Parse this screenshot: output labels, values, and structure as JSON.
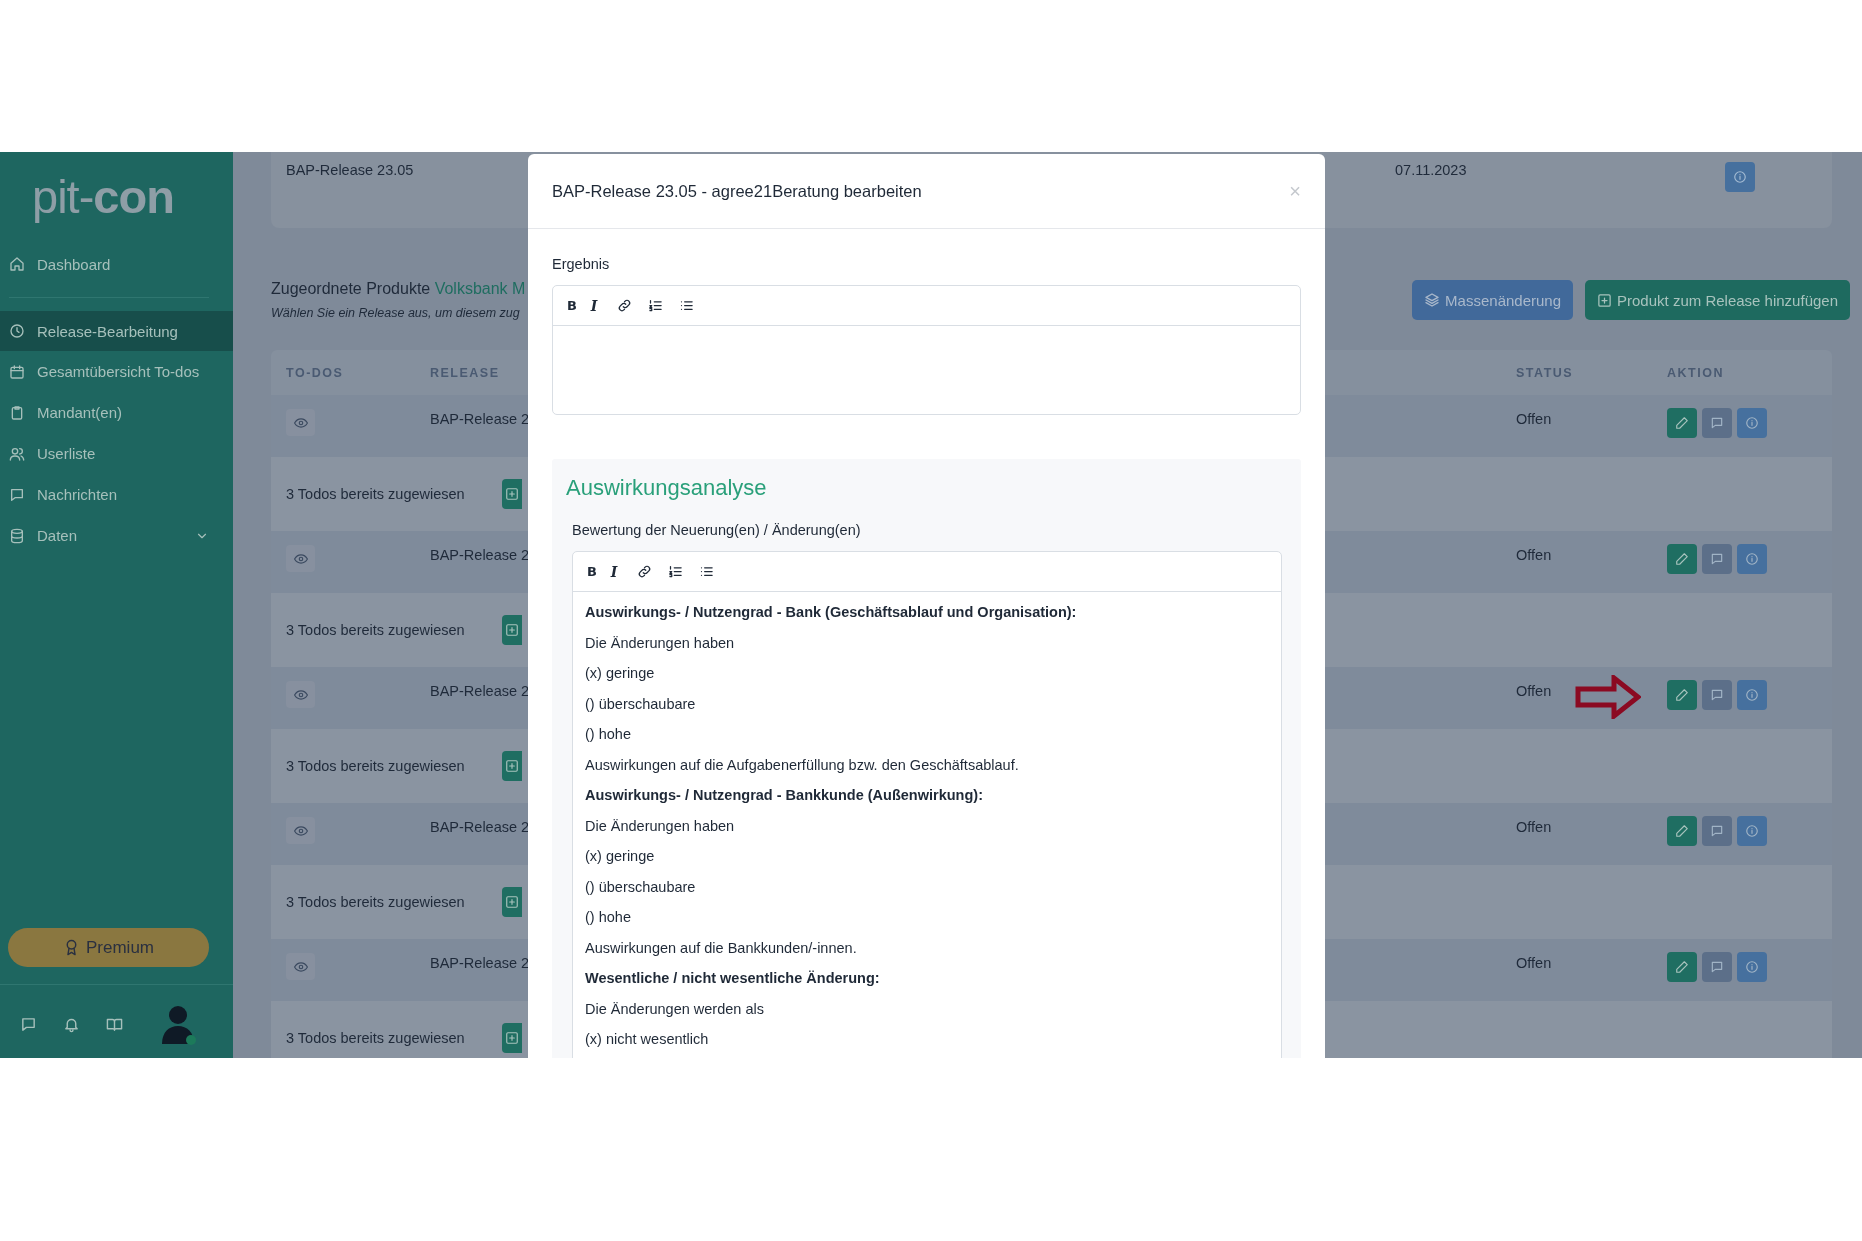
{
  "sidebar": {
    "logo": "pit-**con**",
    "items": [
      {
        "label": "Dashboard",
        "kind": "link",
        "selected": false
      },
      {
        "label": "Release-Bearbeitung",
        "kind": "link",
        "selected": true
      },
      {
        "label": "Gesamtübersicht To-dos",
        "kind": "link",
        "selected": false
      },
      {
        "label": "Mandant(en)",
        "kind": "link",
        "selected": false
      },
      {
        "label": "Userliste",
        "kind": "link",
        "selected": false
      },
      {
        "label": "Nachrichten",
        "kind": "link",
        "selected": false
      },
      {
        "label": "Daten",
        "kind": "group",
        "selected": false
      }
    ],
    "premium_button": "Premium"
  },
  "top_card": {
    "release": "BAP-Release 23.05",
    "date": "07.11.2023"
  },
  "section": {
    "title": "Zugeordnete Produkte",
    "link": "Volksbank M",
    "subtitle": "Wählen Sie ein Release aus, um diesem zug",
    "buttons": [
      "Massenänderung",
      "Produkt zum Release hinzufügen"
    ]
  },
  "table": {
    "columns": [
      "TO-DOS",
      "RELEASE",
      "STATUS",
      "AKTION"
    ],
    "rows": [
      {
        "kind": "release",
        "release": "BAP-Release 2",
        "status": "Offen",
        "marked": false
      },
      {
        "kind": "todos",
        "text": "3 Todos bereits zugewiesen"
      },
      {
        "kind": "release",
        "release": "BAP-Release 2",
        "status": "Offen",
        "marked": false
      },
      {
        "kind": "todos",
        "text": "3 Todos bereits zugewiesen"
      },
      {
        "kind": "release",
        "release": "BAP-Release 2",
        "status": "Offen",
        "marked": true
      },
      {
        "kind": "todos",
        "text": "3 Todos bereits zugewiesen"
      },
      {
        "kind": "release",
        "release": "BAP-Release 2",
        "status": "Offen",
        "marked": false
      },
      {
        "kind": "todos",
        "text": "3 Todos bereits zugewiesen"
      },
      {
        "kind": "release",
        "release": "BAP-Release 2",
        "status": "Offen",
        "marked": false
      },
      {
        "kind": "todos",
        "text": "3 Todos bereits zugewiesen"
      }
    ]
  },
  "modal": {
    "title": "BAP-Release 23.05 - agree21Beratung bearbeiten",
    "close": "×",
    "result_label": "Ergebnis",
    "result_toolbar": [
      {
        "kind": "bold",
        "label": "B"
      },
      {
        "kind": "italic",
        "label": "I"
      },
      {
        "kind": "link"
      },
      {
        "kind": "ordered-list"
      },
      {
        "kind": "bullet-list"
      }
    ],
    "section_title": "Auswirkungsanalyse",
    "assessment_label": "Bewertung der Neuerung(en) / Änderung(en)",
    "assessment_toolbar": [
      {
        "kind": "bold",
        "label": "B"
      },
      {
        "kind": "italic",
        "label": "I"
      },
      {
        "kind": "link"
      },
      {
        "kind": "ordered-list"
      },
      {
        "kind": "bullet-list"
      }
    ],
    "assessment_lines": [
      {
        "text": "Auswirkungs- / Nutzengrad - Bank (Geschäftsablauf und Organisation):",
        "bold": true
      },
      {
        "text": "Die Änderungen haben",
        "bold": false
      },
      {
        "text": "(x) geringe",
        "bold": false
      },
      {
        "text": "() überschaubare",
        "bold": false
      },
      {
        "text": "() hohe",
        "bold": false
      },
      {
        "text": "Auswirkungen auf die Aufgabenerfüllung bzw. den Geschäftsablauf.",
        "bold": false
      },
      {
        "text": "Auswirkungs- / Nutzengrad - Bankkunde (Außenwirkung):",
        "bold": true
      },
      {
        "text": "Die Änderungen haben",
        "bold": false
      },
      {
        "text": "(x) geringe",
        "bold": false
      },
      {
        "text": "() überschaubare",
        "bold": false
      },
      {
        "text": "() hohe",
        "bold": false
      },
      {
        "text": "Auswirkungen auf die Bankkunden/-innen.",
        "bold": false
      },
      {
        "text": "Wesentliche / nicht wesentliche Änderung:",
        "bold": true
      },
      {
        "text": "Die Änderungen werden als",
        "bold": false
      },
      {
        "text": "(x) nicht wesentlich",
        "bold": false
      }
    ]
  }
}
